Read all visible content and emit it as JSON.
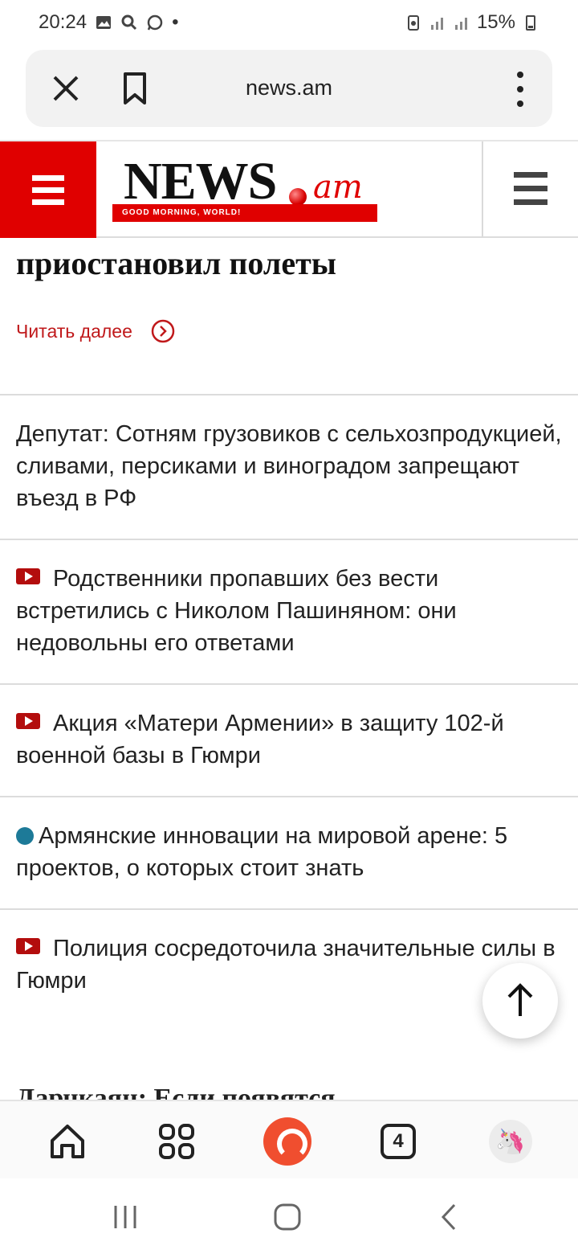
{
  "status_bar": {
    "time": "20:24",
    "battery": "15%",
    "notification_dot": "•"
  },
  "url_bar": {
    "url": "news.am"
  },
  "site": {
    "logo_text": "NEWS",
    "logo_suffix": "am",
    "logo_tagline": "GOOD MORNING, WORLD!"
  },
  "content": {
    "top_headline": "приостановил полеты",
    "read_more_label": "Читать далее",
    "news_items": [
      {
        "icon": "none",
        "text": "Депутат: Сотням грузовиков с сельхозпродукцией, сливами, персиками и виноградом запрещают въезд в РФ"
      },
      {
        "icon": "video-icon",
        "text": "Родственники пропавших без вести встретились с Николом Пашиняном: они недовольны его ответами"
      },
      {
        "icon": "video-icon",
        "text": "Акция «Матери Армении» в защиту 102-й военной базы в Гюмри"
      },
      {
        "icon": "dot-icon",
        "text": "Армянские инновации на мировой арене: 5 проектов, о которых стоит знать"
      },
      {
        "icon": "video-icon",
        "text": "Полиция сосредоточила значительные силы в Гюмри"
      }
    ],
    "partial_headline": "Дарчкаян: Если появятся"
  },
  "bottom_bar": {
    "tabs_count": "4"
  },
  "colors": {
    "brand_red": "#e00000",
    "read_more_red": "#c0191b",
    "video_red": "#b30d0d",
    "dot_blue": "#1d7a98",
    "alice_orange": "#f04e2f"
  }
}
